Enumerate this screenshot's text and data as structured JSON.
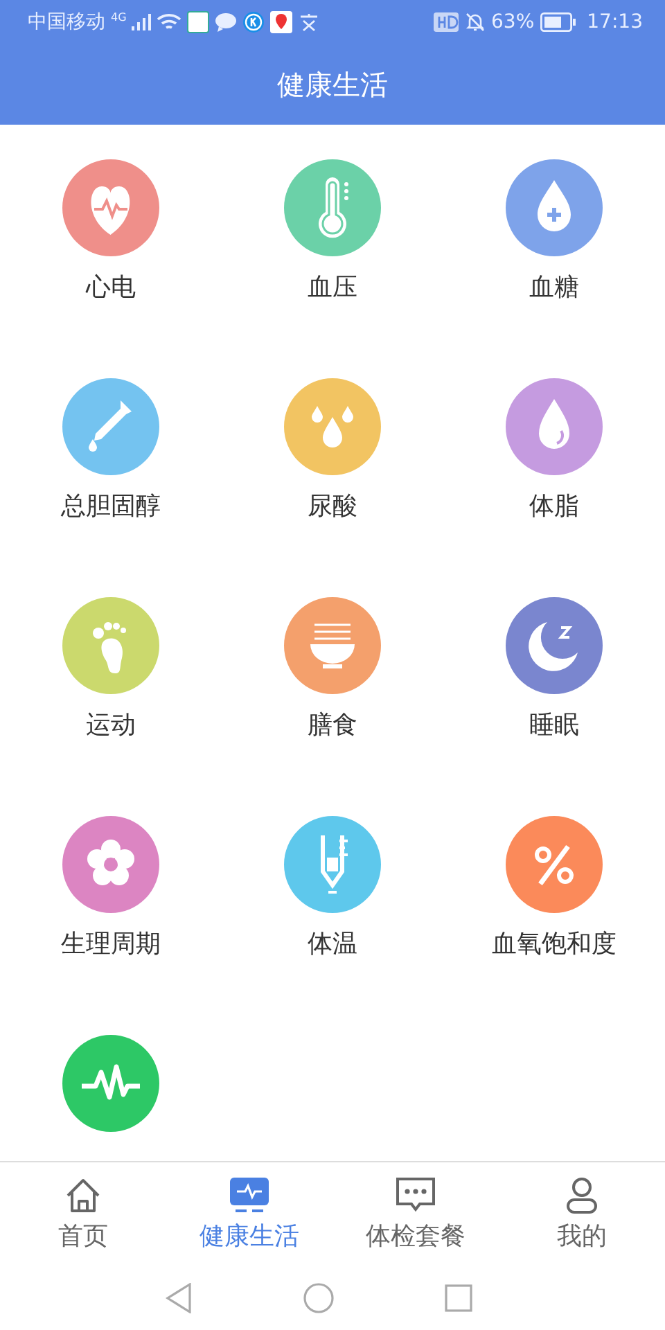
{
  "status_bar": {
    "carrier": "中国移动",
    "network": "4G",
    "battery": "63%",
    "time": "17:13"
  },
  "header": {
    "title": "健康生活"
  },
  "features": [
    {
      "label": "心电",
      "kind": "heart",
      "color": "#ef8f8a"
    },
    {
      "label": "血压",
      "kind": "thermometer",
      "color": "#6bd1a8"
    },
    {
      "label": "血糖",
      "kind": "dropplus",
      "color": "#7ea3ea"
    },
    {
      "label": "总胆固醇",
      "kind": "dropper",
      "color": "#74c3f0"
    },
    {
      "label": "尿酸",
      "kind": "drops",
      "color": "#f2c462"
    },
    {
      "label": "体脂",
      "kind": "drop",
      "color": "#c59be0"
    },
    {
      "label": "运动",
      "kind": "foot",
      "color": "#cbd96d"
    },
    {
      "label": "膳食",
      "kind": "bowl",
      "color": "#f4a06c"
    },
    {
      "label": "睡眠",
      "kind": "moon",
      "color": "#7a86cf"
    },
    {
      "label": "生理周期",
      "kind": "flower",
      "color": "#dc85c2"
    },
    {
      "label": "体温",
      "kind": "tube",
      "color": "#5ec8ec"
    },
    {
      "label": "血氧饱和度",
      "kind": "percent",
      "color": "#fb8a5a"
    },
    {
      "kind": "pulse",
      "color": "#2dc866"
    }
  ],
  "tabs": [
    {
      "label": "首页",
      "kind": "home",
      "selected": false
    },
    {
      "label": "健康生活",
      "kind": "monitor",
      "selected": true
    },
    {
      "label": "体检套餐",
      "kind": "chat",
      "selected": false
    },
    {
      "label": "我的",
      "kind": "person",
      "selected": false
    }
  ]
}
